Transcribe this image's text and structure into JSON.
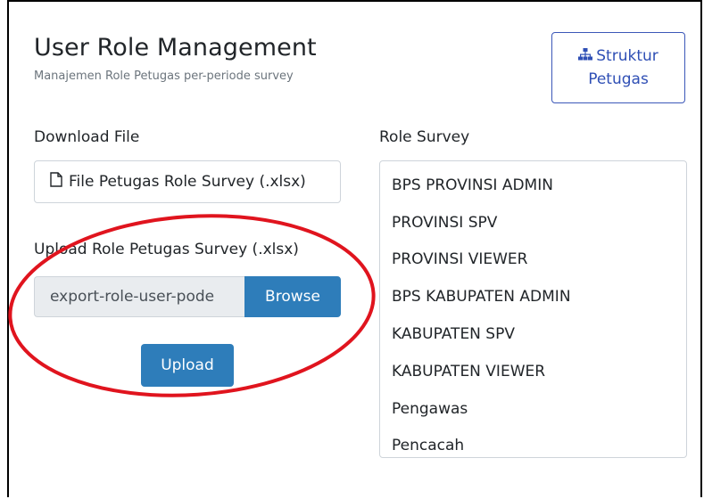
{
  "header": {
    "title": "User Role Management",
    "subtitle": "Manajemen Role Petugas per-periode survey"
  },
  "struktur_button": {
    "icon": "sitemap-icon",
    "line1": "Struktur",
    "line2": "Petugas",
    "color": "#2f4fb5"
  },
  "download": {
    "label": "Download File",
    "button_icon": "file-icon",
    "button_label": "File Petugas Role Survey (.xlsx)"
  },
  "upload": {
    "label": "Upload Role Petugas Survey (.xlsx)",
    "file_value": "export-role-user-pode",
    "browse_label": "Browse",
    "upload_label": "Upload",
    "accent_color": "#2e7dba"
  },
  "role_survey": {
    "label": "Role Survey",
    "items": [
      "BPS PROVINSI ADMIN",
      "PROVINSI SPV",
      "PROVINSI VIEWER",
      "BPS KABUPATEN ADMIN",
      "KABUPATEN SPV",
      "KABUPATEN VIEWER",
      "Pengawas",
      "Pencacah"
    ]
  },
  "annotation": {
    "shape": "red-ellipse",
    "color": "#e0141e"
  }
}
